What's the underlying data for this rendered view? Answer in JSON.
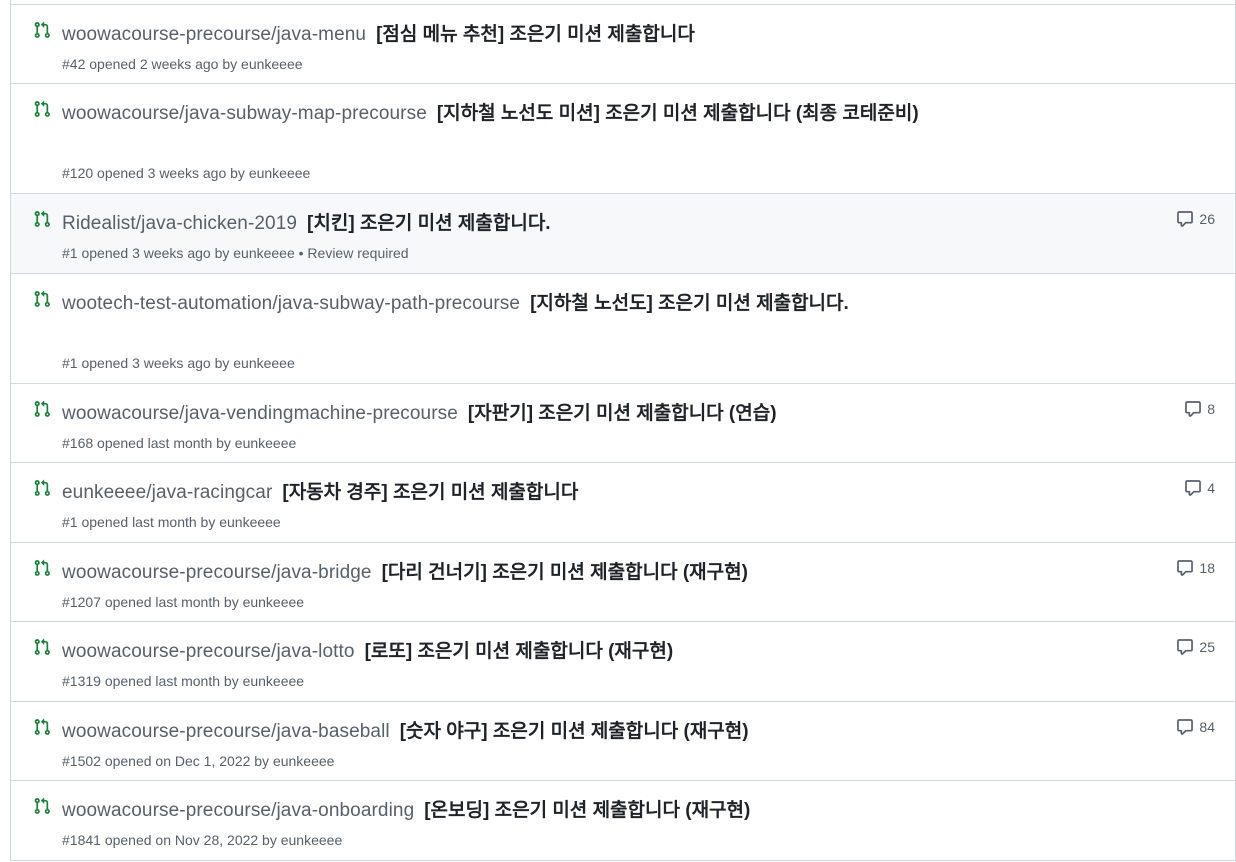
{
  "colors": {
    "pr_open_icon": "#1a7f37",
    "text_muted": "#57606a",
    "text_primary": "#1f2328",
    "border": "#d0d7de",
    "hover_bg": "#f6f8fa"
  },
  "pull_requests": [
    {
      "repo": "woowacourse-precourse/java-menu",
      "title": "[점심 메뉴 추천] 조은기 미션 제출합니다",
      "meta": "#42 opened 2 weeks ago by eunkeeee",
      "comments": ""
    },
    {
      "repo": "woowacourse/java-subway-map-precourse",
      "title": "[지하철 노선도 미션] 조은기 미션 제출합니다 (최종 코테준비)",
      "meta": "#120 opened 3 weeks ago by eunkeeee",
      "comments": ""
    },
    {
      "repo": "Ridealist/java-chicken-2019",
      "title": "[치킨] 조은기 미션 제출합니다.",
      "meta": "#1 opened 3 weeks ago by eunkeeee • Review required",
      "comments": "26"
    },
    {
      "repo": "wootech-test-automation/java-subway-path-precourse",
      "title": "[지하철 노선도] 조은기 미션 제출합니다.",
      "meta": "#1 opened 3 weeks ago by eunkeeee",
      "comments": ""
    },
    {
      "repo": "woowacourse/java-vendingmachine-precourse",
      "title": "[자판기] 조은기 미션 제출합니다 (연습)",
      "meta": "#168 opened last month by eunkeeee",
      "comments": "8"
    },
    {
      "repo": "eunkeeee/java-racingcar",
      "title": "[자동차 경주] 조은기 미션 제출합니다",
      "meta": "#1 opened last month by eunkeeee",
      "comments": "4"
    },
    {
      "repo": "woowacourse-precourse/java-bridge",
      "title": "[다리 건너기] 조은기 미션 제출합니다 (재구현)",
      "meta": "#1207 opened last month by eunkeeee",
      "comments": "18"
    },
    {
      "repo": "woowacourse-precourse/java-lotto",
      "title": "[로또] 조은기 미션 제출합니다 (재구현)",
      "meta": "#1319 opened last month by eunkeeee",
      "comments": "25"
    },
    {
      "repo": "woowacourse-precourse/java-baseball",
      "title": "[숫자 야구] 조은기 미션 제출합니다 (재구현)",
      "meta": "#1502 opened on Dec 1, 2022 by eunkeeee",
      "comments": "84"
    },
    {
      "repo": "woowacourse-precourse/java-onboarding",
      "title": "[온보딩] 조은기 미션 제출합니다 (재구현)",
      "meta": "#1841 opened on Nov 28, 2022 by eunkeeee",
      "comments": ""
    }
  ]
}
